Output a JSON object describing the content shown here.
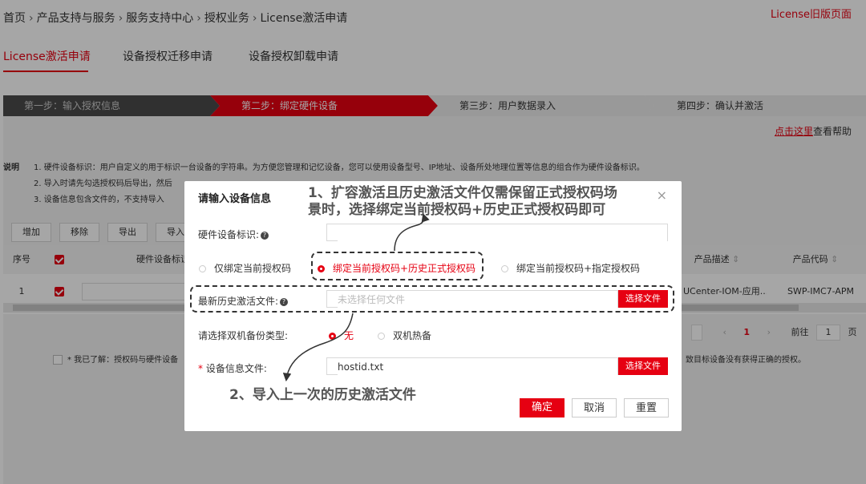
{
  "breadcrumb": [
    "首页",
    "产品支持与服务",
    "服务支持中心",
    "授权业务",
    "License激活申请"
  ],
  "breadcrumb_sep": "›",
  "old_version_link": "License旧版页面",
  "tabs": [
    {
      "label": "License激活申请",
      "active": true
    },
    {
      "label": "设备授权迁移申请",
      "active": false
    },
    {
      "label": "设备授权卸载申请",
      "active": false
    }
  ],
  "steps": [
    {
      "label": "第一步：输入授权信息",
      "state": "done"
    },
    {
      "label": "第二步：绑定硬件设备",
      "state": "active"
    },
    {
      "label": "第三步：用户数据录入",
      "state": "todo"
    },
    {
      "label": "第四步：确认并激活",
      "state": "todo"
    }
  ],
  "help": {
    "link": "点击这里",
    "suffix": "查看帮助"
  },
  "description": {
    "title": "说明",
    "lines": [
      "1. 硬件设备标识：用户自定义的用于标识一台设备的字符串。为方便您管理和记忆设备，您可以使用设备型号、IP地址、设备所处地理位置等信息的组合作为硬件设备标识。",
      "2. 导入时请先勾选授权码后导出，然后",
      "3. 设备信息包含文件的，不支持导入"
    ]
  },
  "toolbar": [
    "增加",
    "移除",
    "导出",
    "导入"
  ],
  "table": {
    "headers": [
      "序号",
      "",
      "硬件设备标识",
      "产品描述",
      "产品代码"
    ],
    "row": {
      "index": "1",
      "desc": "UCenter-IOM-应用...",
      "code": "SWP-IMC7-APM"
    }
  },
  "pager": {
    "page": "1",
    "goto_label": "前往",
    "goto_value": "1",
    "page_unit": "页"
  },
  "agree_text": "* 我已了解：授权码与硬件设备",
  "agree_text_right": "致目标设备没有获得正确的授权。",
  "colors": {
    "accent": "#e60012",
    "step_done": "#4a4a4a",
    "step_active": "#e60012",
    "step_todo": "#ececec"
  },
  "modal": {
    "title": "请输入设备信息",
    "close_icon": "close-icon",
    "hw_label": "硬件设备标识:",
    "hw_value": "",
    "bind_options": [
      {
        "label": "仅绑定当前授权码",
        "selected": false
      },
      {
        "label": "绑定当前授权码+历史正式授权码",
        "selected": true
      },
      {
        "label": "绑定当前授权码+指定授权码",
        "selected": false
      }
    ],
    "history_label": "最新历史激活文件:",
    "history_placeholder": "未选择任何文件",
    "choose_file": "选择文件",
    "backup_label": "请选择双机备份类型:",
    "backup_options": [
      {
        "label": "无",
        "selected": true
      },
      {
        "label": "双机热备",
        "selected": false
      }
    ],
    "device_file_label": "设备信息文件:",
    "device_file_required": "*",
    "device_file_value": "hostid.txt",
    "buttons": {
      "confirm": "确定",
      "cancel": "取消",
      "reset": "重置"
    }
  },
  "annotations": {
    "note1_line1": "1、扩容激活且历史激活文件仅需保留正式授权码场",
    "note1_line2": "景时，选择绑定当前授权码+历史正式授权码即可",
    "note2": "2、导入上一次的历史激活文件"
  }
}
